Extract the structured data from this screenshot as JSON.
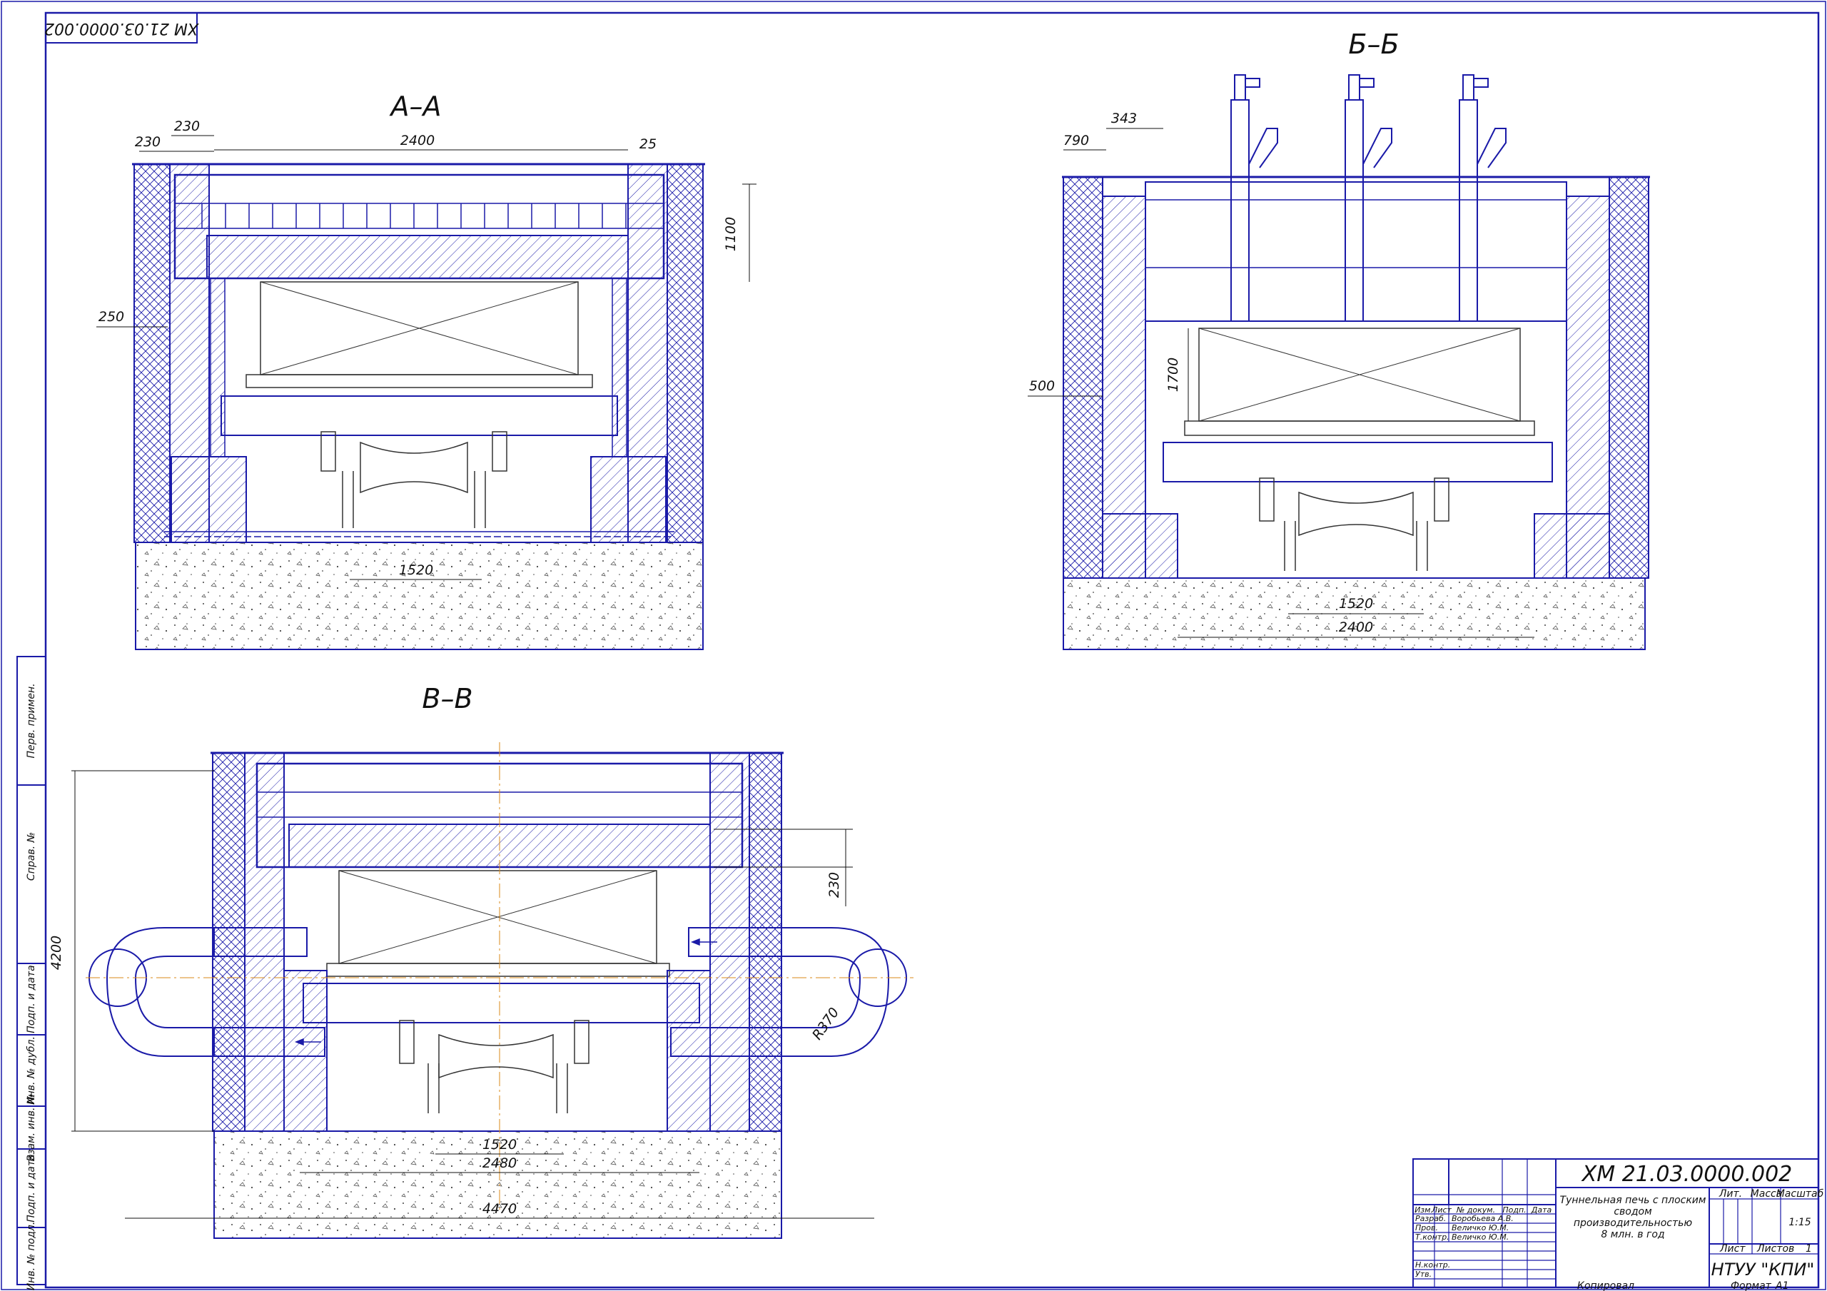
{
  "drawing": {
    "stamp_code": "ХМ 21.03.0000.002",
    "sections": {
      "aa": {
        "title": "А–А",
        "dims": {
          "d230a": "230",
          "d230b": "230",
          "d2400": "2400",
          "d25": "25",
          "d1100": "1100",
          "d250": "250",
          "d1520": "1520"
        }
      },
      "bb": {
        "title": "Б–Б",
        "dims": {
          "d343": "343",
          "d790": "790",
          "d500": "500",
          "d1700": "1700",
          "d1520": "1520",
          "d2400": "2400"
        }
      },
      "vv": {
        "title": "В–В",
        "dims": {
          "d4200": "4200",
          "d230": "230",
          "r370": "R370",
          "d1520": "1520",
          "d2480": "2480",
          "d4470": "4470"
        }
      }
    },
    "side_stamp": [
      "Перв. примен.",
      "Справ. №",
      "Подп. и дата",
      "Инв. № дубл.",
      "Взам. инв. №",
      "Подп. и дата",
      "Инв. № подл."
    ],
    "title_block": {
      "doc_code": "ХМ 21.03.0000.002",
      "name_lines": [
        "Туннельная печь с плоским",
        "сводом",
        "производительностью",
        "8 млн. в год"
      ],
      "cols": {
        "izm": "Изм.",
        "list": "Лист",
        "ndoc": "№ докум.",
        "podp": "Подп.",
        "data": "Дата"
      },
      "rows": [
        {
          "role": "Разраб.",
          "person": "Воробьева А.В."
        },
        {
          "role": "Пров.",
          "person": "Величко Ю.М."
        },
        {
          "role": "Т.контр.",
          "person": "Величко Ю.М."
        },
        {
          "role": "",
          "person": ""
        },
        {
          "role": "Н.контр.",
          "person": ""
        },
        {
          "role": "Утв.",
          "person": ""
        }
      ],
      "lit_label": "Лит.",
      "mass_label": "Масса",
      "scale_label": "Масштаб",
      "scale_value": "1:15",
      "sheet_label": "Лист",
      "sheets_label": "Листов",
      "sheets_value": "1",
      "org": "НТУУ \"КПИ\"",
      "copied": "Копировал",
      "format_label": "Формат",
      "format_value": "А1"
    }
  }
}
